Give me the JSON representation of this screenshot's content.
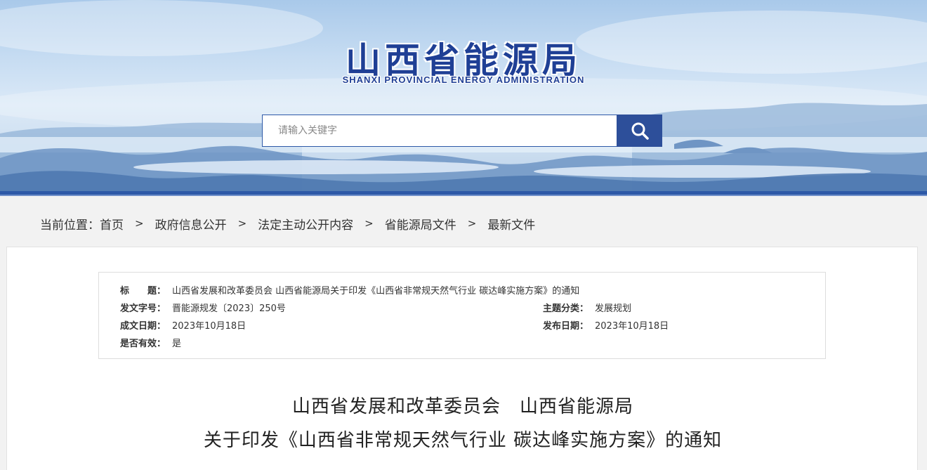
{
  "site": {
    "name_cn": "山西省能源局",
    "name_en": "SHANXI PROVINCIAL ENERGY ADMINISTRATION"
  },
  "search": {
    "placeholder": "请输入关键字",
    "icon": "search-icon"
  },
  "breadcrumb": {
    "label": "当前位置：",
    "items": [
      "首页",
      "政府信息公开",
      "法定主动公开内容",
      "省能源局文件",
      "最新文件"
    ],
    "separator": ">"
  },
  "meta": {
    "title_label": "标　　题：",
    "title_value": "山西省发展和改革委员会 山西省能源局关于印发《山西省非常规天然气行业 碳达峰实施方案》的通知",
    "doc_no_label": "发文字号：",
    "doc_no_value": "晋能源规发〔2023〕250号",
    "topic_label": "主题分类：",
    "topic_value": "发展规划",
    "created_label": "成文日期：",
    "created_value": "2023年10月18日",
    "published_label": "发布日期：",
    "published_value": "2023年10月18日",
    "valid_label": "是否有效：",
    "valid_value": "是"
  },
  "document": {
    "title_line1": "山西省发展和改革委员会　山西省能源局",
    "title_line2": "关于印发《山西省非常规天然气行业 碳达峰实施方案》的通知"
  },
  "colors": {
    "brand": "#1f3f95",
    "accent_bar": "#2d59a7",
    "search_button": "#2d4f9a"
  }
}
